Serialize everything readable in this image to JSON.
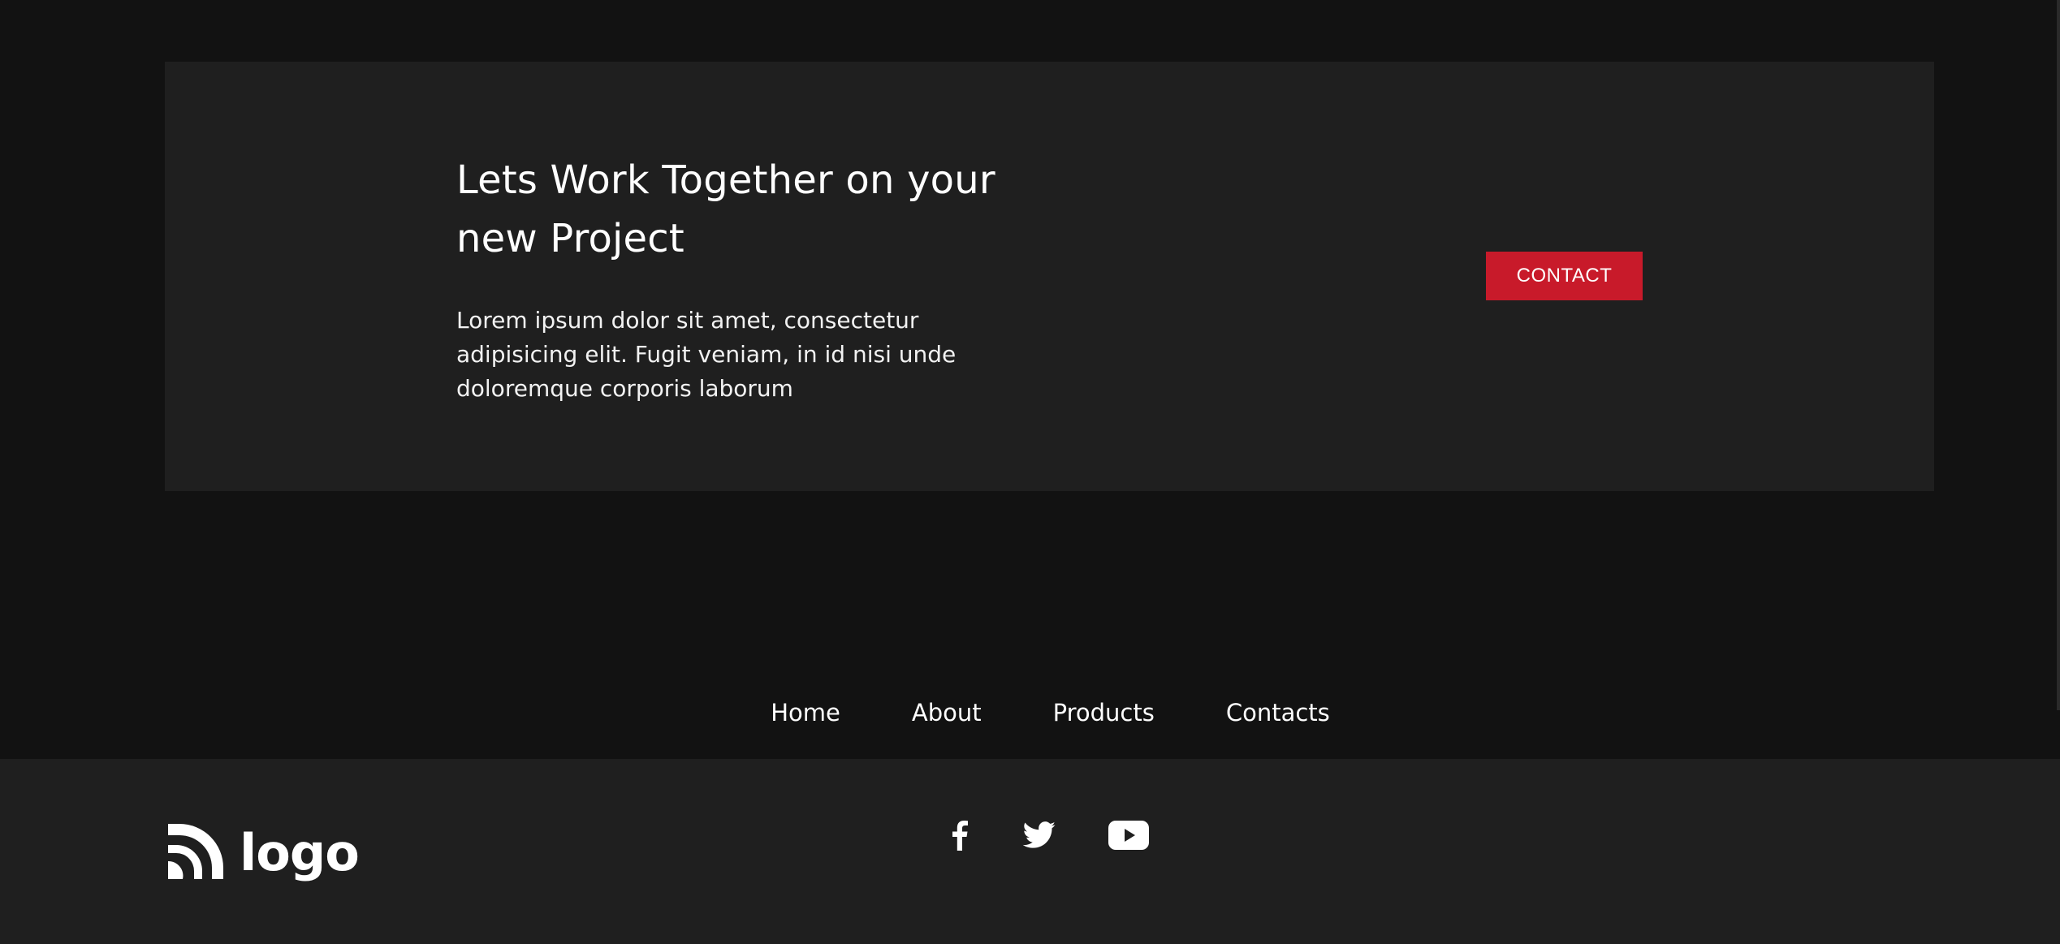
{
  "cta": {
    "title": "Lets Work Together on your new Project",
    "body": "Lorem ipsum dolor sit amet, consectetur adipisicing elit. Fugit veniam, in id nisi unde doloremque corporis laborum",
    "button_label": "CONTACT"
  },
  "nav": {
    "items": [
      {
        "label": "Home"
      },
      {
        "label": "About"
      },
      {
        "label": "Products"
      },
      {
        "label": "Contacts"
      }
    ]
  },
  "footer": {
    "logo_text": "logo",
    "social": [
      {
        "icon": "facebook-icon"
      },
      {
        "icon": "twitter-icon"
      },
      {
        "icon": "youtube-icon"
      }
    ]
  },
  "colors": {
    "page_background": "#121212",
    "card_background": "#1f1f1f",
    "accent": "#c81a2a",
    "text": "#ffffff"
  }
}
